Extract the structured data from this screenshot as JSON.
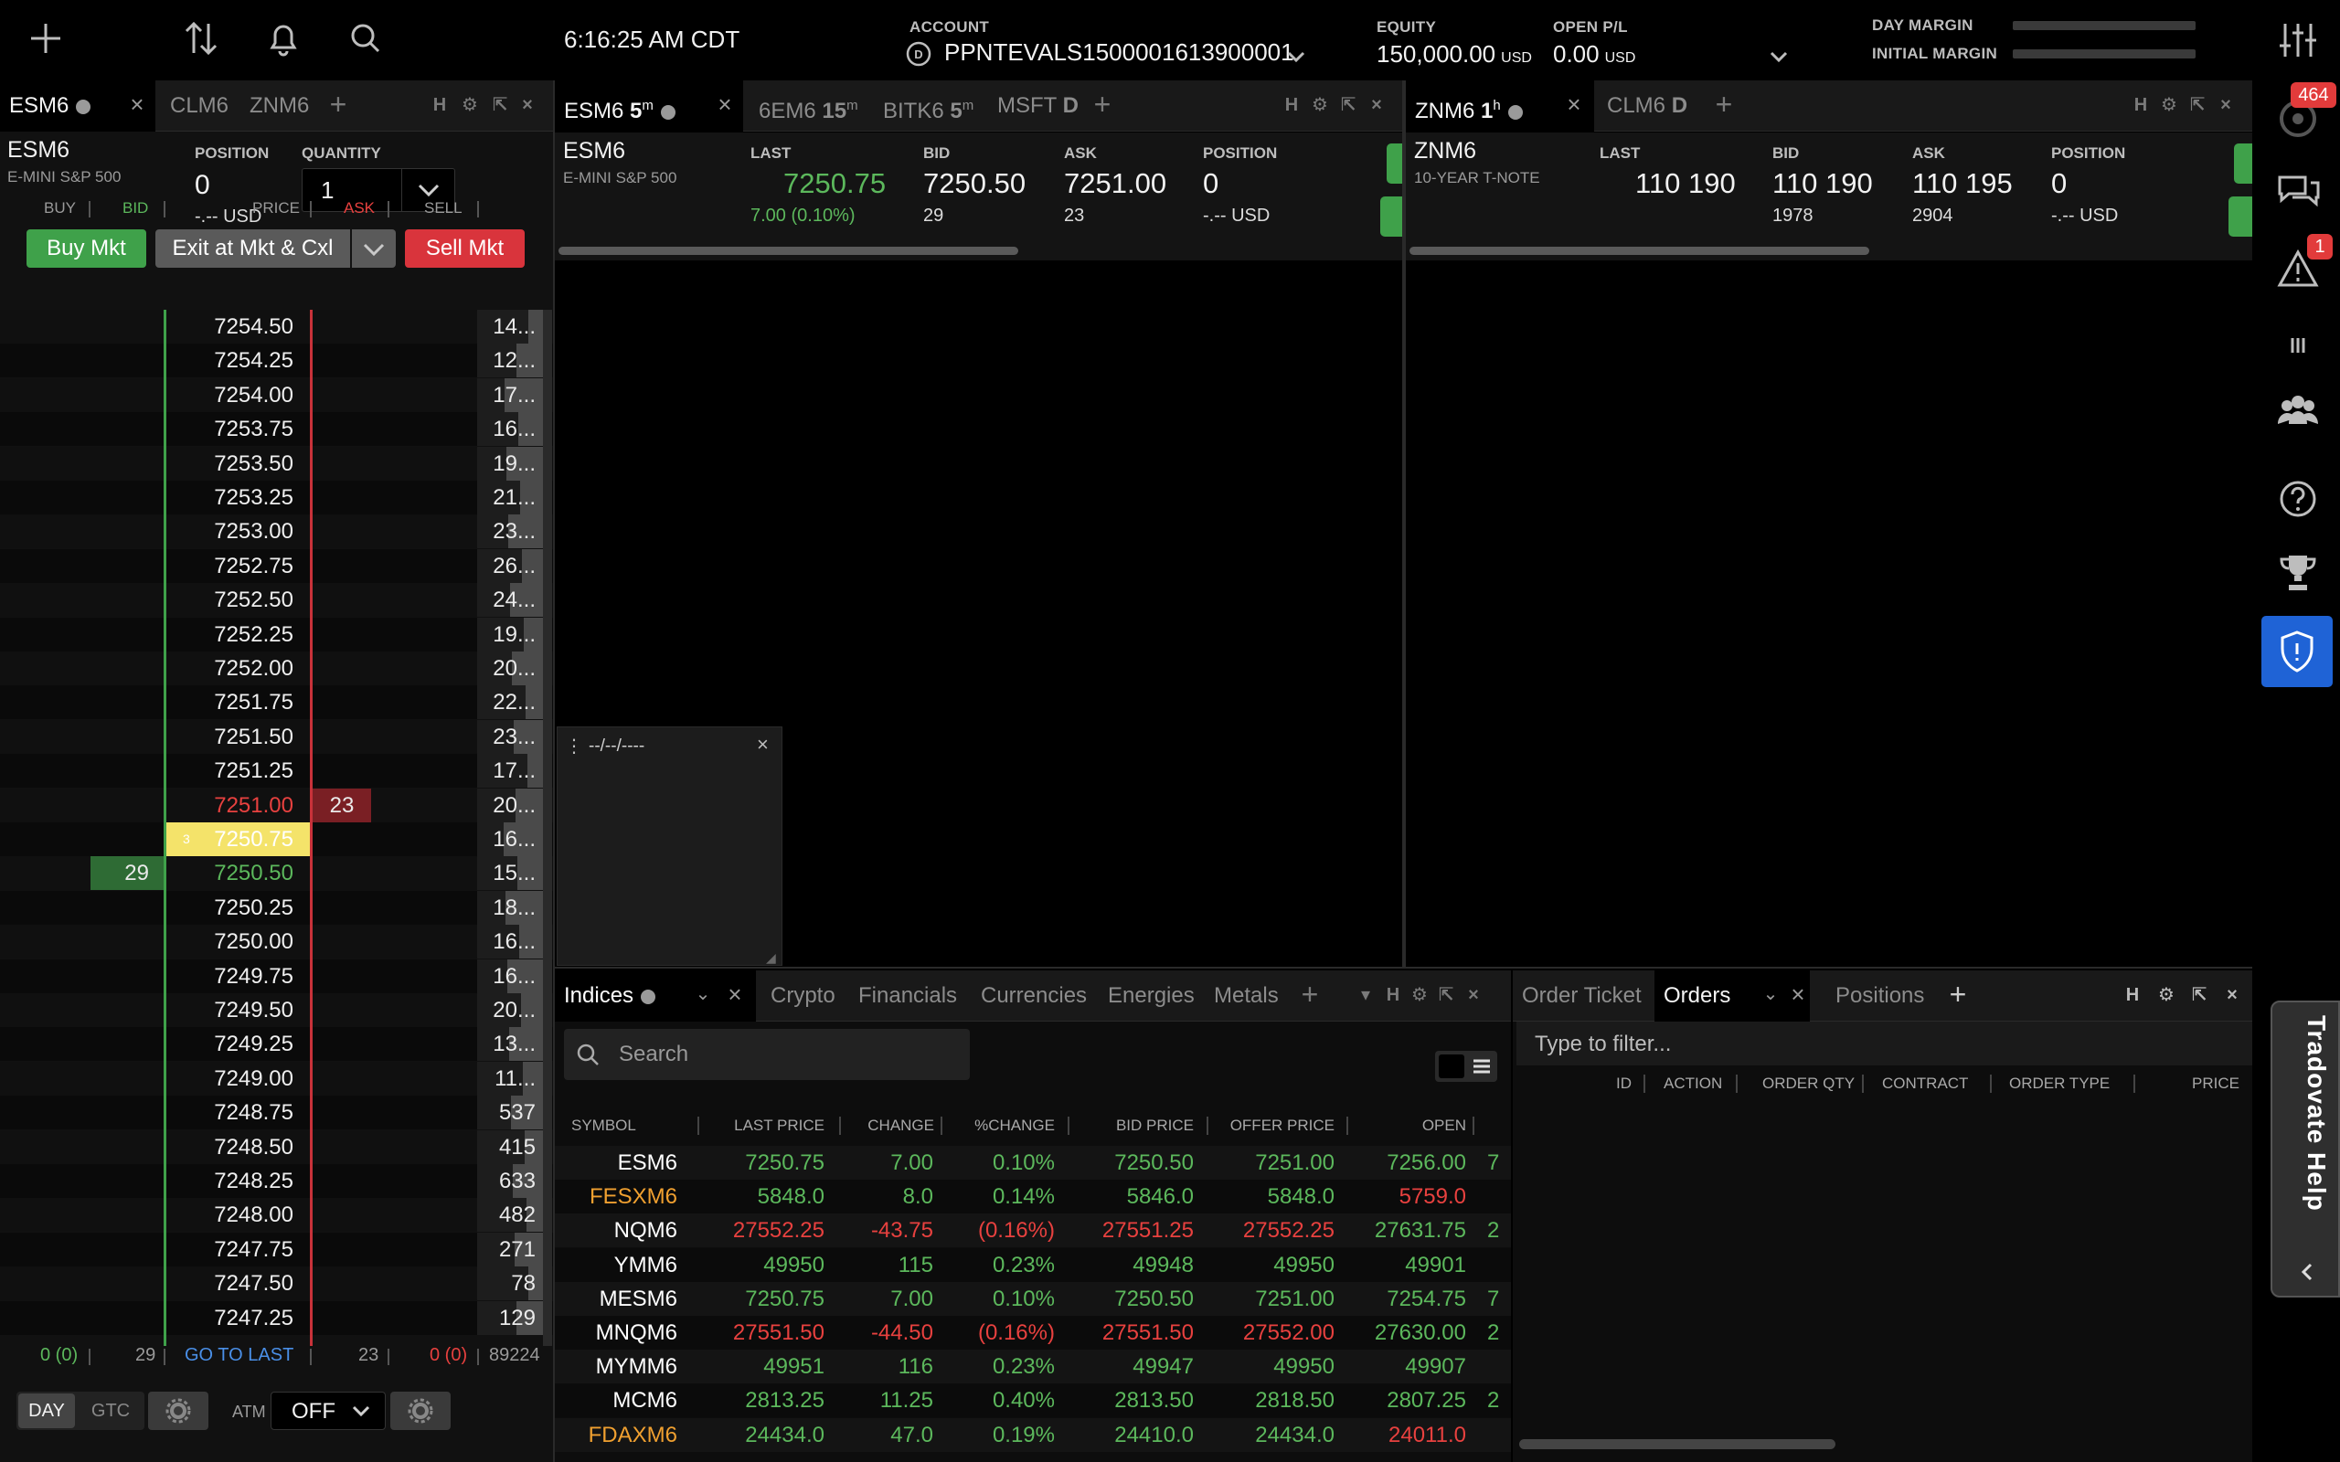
{
  "topbar": {
    "time": "6:16:25 AM CDT",
    "account_label": "ACCOUNT",
    "account_value": "PPNTEVALS1500001613900001",
    "equity_label": "EQUITY",
    "equity_value": "150,000.00",
    "equity_unit": "USD",
    "openpl_label": "OPEN P/L",
    "openpl_value": "0.00",
    "openpl_unit": "USD",
    "day_margin_label": "DAY MARGIN",
    "day_margin_pct": "0%",
    "initial_margin_label": "INITIAL MARGIN",
    "initial_margin_pct": "0%"
  },
  "dom": {
    "tabs": [
      "ESM6",
      "CLM6",
      "ZNM6"
    ],
    "symbol": "ESM6",
    "description": "E-MINI S&P 500",
    "position_label": "POSITION",
    "position_value": "0",
    "position_usd": "-.-- USD",
    "quantity_label": "QUANTITY",
    "quantity_value": "1",
    "buy_mkt": "Buy Mkt",
    "exit_btn": "Exit at Mkt & Cxl",
    "sell_mkt": "Sell Mkt",
    "col_buy": "BUY",
    "col_bid": "BID",
    "col_price": "PRICE",
    "col_ask": "ASK",
    "col_sell": "SELL",
    "rows": [
      {
        "price": "7254.50",
        "sell": "14..."
      },
      {
        "price": "7254.25",
        "sell": "12..."
      },
      {
        "price": "7254.00",
        "sell": "17..."
      },
      {
        "price": "7253.75",
        "sell": "16..."
      },
      {
        "price": "7253.50",
        "sell": "19..."
      },
      {
        "price": "7253.25",
        "sell": "21..."
      },
      {
        "price": "7253.00",
        "sell": "23..."
      },
      {
        "price": "7252.75",
        "sell": "26..."
      },
      {
        "price": "7252.50",
        "sell": "24..."
      },
      {
        "price": "7252.25",
        "sell": "19..."
      },
      {
        "price": "7252.00",
        "sell": "20..."
      },
      {
        "price": "7251.75",
        "sell": "22..."
      },
      {
        "price": "7251.50",
        "sell": "23..."
      },
      {
        "price": "7251.25",
        "sell": "17..."
      },
      {
        "price": "7251.00",
        "sell": "20...",
        "ask": "23"
      },
      {
        "price": "7250.75",
        "sell": "16...",
        "last": "3"
      },
      {
        "price": "7250.50",
        "sell": "15...",
        "bid": "29"
      },
      {
        "price": "7250.25",
        "sell": "18..."
      },
      {
        "price": "7250.00",
        "sell": "16..."
      },
      {
        "price": "7249.75",
        "sell": "16..."
      },
      {
        "price": "7249.50",
        "sell": "20..."
      },
      {
        "price": "7249.25",
        "sell": "13..."
      },
      {
        "price": "7249.00",
        "sell": "11..."
      },
      {
        "price": "7248.75",
        "sell": "537"
      },
      {
        "price": "7248.50",
        "sell": "415"
      },
      {
        "price": "7248.25",
        "sell": "633"
      },
      {
        "price": "7248.00",
        "sell": "482"
      },
      {
        "price": "7247.75",
        "sell": "271"
      },
      {
        "price": "7247.50",
        "sell": "78"
      },
      {
        "price": "7247.25",
        "sell": "129"
      }
    ],
    "footer_buy": "0 (0)",
    "footer_bid": "29",
    "footer_goto": "GO TO LAST",
    "footer_ask": "23",
    "footer_sell": "0 (0)",
    "footer_total": "89224",
    "day": "DAY",
    "gtc": "GTC",
    "atm_label": "ATM",
    "atm_value": "OFF"
  },
  "quote1": {
    "tabs": [
      {
        "sym": "ESM6",
        "tf": "5",
        "sup": "m"
      },
      {
        "sym": "6EM6",
        "tf": "15",
        "sup": "m"
      },
      {
        "sym": "BITK6",
        "tf": "5",
        "sup": "m"
      },
      {
        "sym": "MSFT",
        "tf": "D",
        "sup": ""
      }
    ],
    "symbol": "ESM6",
    "description": "E-MINI S&P 500",
    "last_label": "LAST",
    "last": "7250.75",
    "change": "7.00 (0.10%)",
    "bid_label": "BID",
    "bid": "7250.50",
    "bid_size": "29",
    "ask_label": "ASK",
    "ask": "7251.00",
    "ask_size": "23",
    "pos_label": "POSITION",
    "pos": "0",
    "pos_usd": "-.-- USD"
  },
  "quote2": {
    "tabs": [
      {
        "sym": "ZNM6",
        "tf": "1",
        "sup": "h"
      },
      {
        "sym": "CLM6",
        "tf": "D",
        "sup": ""
      }
    ],
    "symbol": "ZNM6",
    "description": "10-YEAR T-NOTE",
    "last_label": "LAST",
    "last": "110 190",
    "bid_label": "BID",
    "bid": "110 190",
    "bid_size": "1978",
    "ask_label": "ASK",
    "ask": "110 195",
    "ask_size": "2904",
    "pos_label": "POSITION",
    "pos": "0",
    "pos_usd": "-.-- USD"
  },
  "popup": {
    "date": "--/--/----"
  },
  "watchlist": {
    "tabs": [
      "Indices",
      "Crypto",
      "Financials",
      "Currencies",
      "Energies",
      "Metals"
    ],
    "search_placeholder": "Search",
    "headers": [
      "SYMBOL",
      "LAST PRICE",
      "CHANGE",
      "%CHANGE",
      "BID PRICE",
      "OFFER PRICE",
      "OPEN"
    ],
    "rows": [
      {
        "sym": "ESM6",
        "last": "7250.75",
        "chg": "7.00",
        "pct": "0.10%",
        "bid": "7250.50",
        "offer": "7251.00",
        "open": "7256.00",
        "more": "7",
        "dir": "pos",
        "opendir": "pos",
        "symcolor": "#ffffff"
      },
      {
        "sym": "FESXM6",
        "last": "5848.0",
        "chg": "8.0",
        "pct": "0.14%",
        "bid": "5846.0",
        "offer": "5848.0",
        "open": "5759.0",
        "more": "",
        "dir": "pos",
        "opendir": "neg",
        "symcolor": "#f0a030"
      },
      {
        "sym": "NQM6",
        "last": "27552.25",
        "chg": "-43.75",
        "pct": "(0.16%)",
        "bid": "27551.25",
        "offer": "27552.25",
        "open": "27631.75",
        "more": "2",
        "dir": "neg",
        "opendir": "pos",
        "symcolor": "#ffffff"
      },
      {
        "sym": "YMM6",
        "last": "49950",
        "chg": "115",
        "pct": "0.23%",
        "bid": "49948",
        "offer": "49950",
        "open": "49901",
        "more": "",
        "dir": "pos",
        "opendir": "pos",
        "symcolor": "#ffffff"
      },
      {
        "sym": "MESM6",
        "last": "7250.75",
        "chg": "7.00",
        "pct": "0.10%",
        "bid": "7250.50",
        "offer": "7251.00",
        "open": "7254.75",
        "more": "7",
        "dir": "pos",
        "opendir": "pos",
        "symcolor": "#ffffff"
      },
      {
        "sym": "MNQM6",
        "last": "27551.50",
        "chg": "-44.50",
        "pct": "(0.16%)",
        "bid": "27551.50",
        "offer": "27552.00",
        "open": "27630.00",
        "more": "2",
        "dir": "neg",
        "opendir": "pos",
        "symcolor": "#ffffff"
      },
      {
        "sym": "MYMM6",
        "last": "49951",
        "chg": "116",
        "pct": "0.23%",
        "bid": "49947",
        "offer": "49950",
        "open": "49907",
        "more": "",
        "dir": "pos",
        "opendir": "pos",
        "symcolor": "#ffffff"
      },
      {
        "sym": "MCM6",
        "last": "2813.25",
        "chg": "11.25",
        "pct": "0.40%",
        "bid": "2813.50",
        "offer": "2818.50",
        "open": "2807.25",
        "more": "2",
        "dir": "pos",
        "opendir": "pos",
        "symcolor": "#ffffff"
      },
      {
        "sym": "FDAXM6",
        "last": "24434.0",
        "chg": "47.0",
        "pct": "0.19%",
        "bid": "24410.0",
        "offer": "24434.0",
        "open": "24011.0",
        "more": "",
        "dir": "pos",
        "opendir": "neg",
        "symcolor": "#f0a030"
      }
    ]
  },
  "orders": {
    "tabs": [
      "Order Ticket",
      "Orders",
      "Positions"
    ],
    "filter_placeholder": "Type to filter...",
    "headers": [
      "ID",
      "ACTION",
      "ORDER QTY",
      "CONTRACT",
      "ORDER TYPE",
      "PRICE"
    ]
  },
  "sidebar": {
    "badge_top": "464",
    "badge_alert": "1",
    "help_tab": "Tradovate Help"
  },
  "colors": {
    "green": "#5cb85c",
    "red": "#e8413f",
    "buy_btn": "#3fa14a",
    "sell_btn": "#d9343c",
    "accent_blue": "#1f63d6",
    "last_highlight": "#f4e36a"
  }
}
